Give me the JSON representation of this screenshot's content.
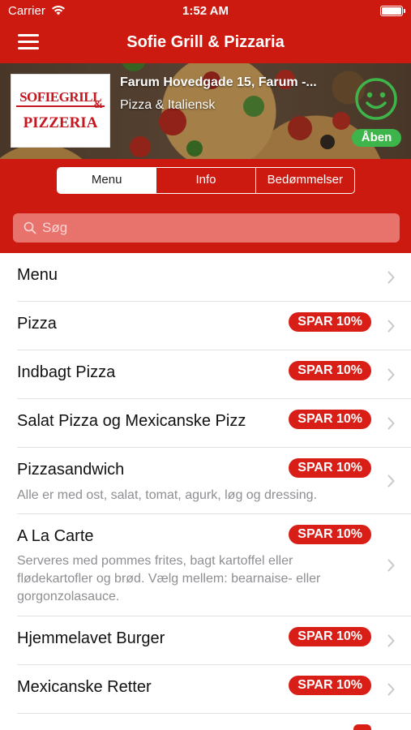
{
  "status_bar": {
    "carrier": "Carrier",
    "time": "1:52 AM"
  },
  "nav": {
    "title": "Sofie Grill & Pizzaria",
    "menu_icon": "hamburger-menu-icon"
  },
  "restaurant": {
    "logo_line1": "SOFIEGRILL",
    "logo_amp": "&",
    "logo_line2": "PIZZERIA",
    "address": "Farum Hovedgade 15, Farum -...",
    "category": "Pizza & Italiensk",
    "status_label": "Åben",
    "status_icon": "smiley-face-icon",
    "status_color": "#3db54a"
  },
  "tabs": [
    {
      "label": "Menu",
      "active": true
    },
    {
      "label": "Info",
      "active": false
    },
    {
      "label": "Bedømmelser",
      "active": false
    }
  ],
  "search": {
    "placeholder": "Søg",
    "value": ""
  },
  "menu": [
    {
      "name": "Menu",
      "badge": "",
      "desc": ""
    },
    {
      "name": "Pizza",
      "badge": "SPAR 10%",
      "desc": ""
    },
    {
      "name": "Indbagt Pizza",
      "badge": "SPAR 10%",
      "desc": ""
    },
    {
      "name": "Salat Pizza og Mexicanske Pizz",
      "badge": "SPAR 10%",
      "desc": ""
    },
    {
      "name": "Pizzasandwich",
      "badge": "SPAR 10%",
      "desc": "Alle er med ost, salat, tomat, agurk, løg og dressing."
    },
    {
      "name": "A La Carte",
      "badge": "SPAR 10%",
      "desc": "Serveres med pommes frites, bagt kartoffel eller flødekartofler og brød. Vælg mellem: bearnaise- eller gorgonzolasauce."
    },
    {
      "name": "Hjemmelavet Burger",
      "badge": "SPAR 10%",
      "desc": ""
    },
    {
      "name": "Mexicanske Retter",
      "badge": "SPAR 10%",
      "desc": ""
    }
  ],
  "colors": {
    "brand_red": "#cc1a10",
    "badge_red": "#d91d17",
    "open_green": "#3db54a"
  }
}
